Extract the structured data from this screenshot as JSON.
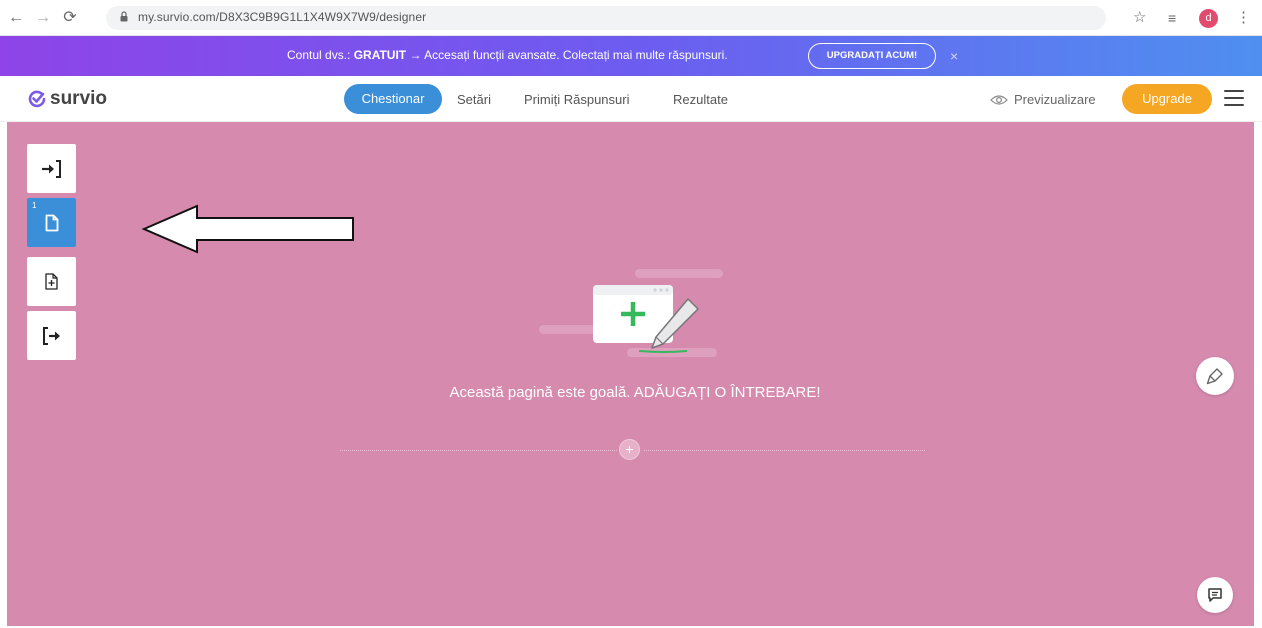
{
  "browser": {
    "url": "my.survio.com/D8X3C9B9G1L1X4W9X7W9/designer",
    "profile_initial": "d",
    "icons": [
      "back-icon",
      "forward-icon",
      "reload-icon",
      "lock-icon",
      "star-icon",
      "reading-list-icon",
      "more-vert-icon"
    ]
  },
  "promo": {
    "prefix": "Contul dvs.: ",
    "plan": "GRATUIT",
    "suffix": " → Accesați funcții avansate. Colectați mai multe răspunsuri.",
    "cta_label": "UPGRADAȚI ACUM!",
    "close_symbol": "×",
    "colors": {
      "start": "#8e44e8",
      "end": "#4f8ff0"
    }
  },
  "header": {
    "logo_text": "survio",
    "tabs": [
      {
        "label": "Chestionar",
        "active": true
      },
      {
        "label": "Setări",
        "active": false
      },
      {
        "label": "Primiți Răspunsuri",
        "active": false
      },
      {
        "label": "Rezultate",
        "active": false
      }
    ],
    "preview_label": "Previzualizare",
    "upgrade_label": "Upgrade",
    "colors": {
      "active_tab": "#3b8fd8",
      "upgrade": "#f5a623"
    }
  },
  "canvas": {
    "background": "#d58aae",
    "side_tools": [
      {
        "name": "intro-page",
        "icon": "enter-arrow-icon"
      },
      {
        "name": "page-1",
        "icon": "page-icon",
        "page_number": "1",
        "active": true
      },
      {
        "name": "add-page",
        "icon": "add-page-icon"
      },
      {
        "name": "end-page",
        "icon": "exit-arrow-icon"
      }
    ],
    "empty_message": "Această pagină este goală. ADĂUGAȚI O ÎNTREBARE!",
    "add_symbol": "+",
    "floating": [
      "paint-brush-icon",
      "chat-feedback-icon"
    ]
  }
}
